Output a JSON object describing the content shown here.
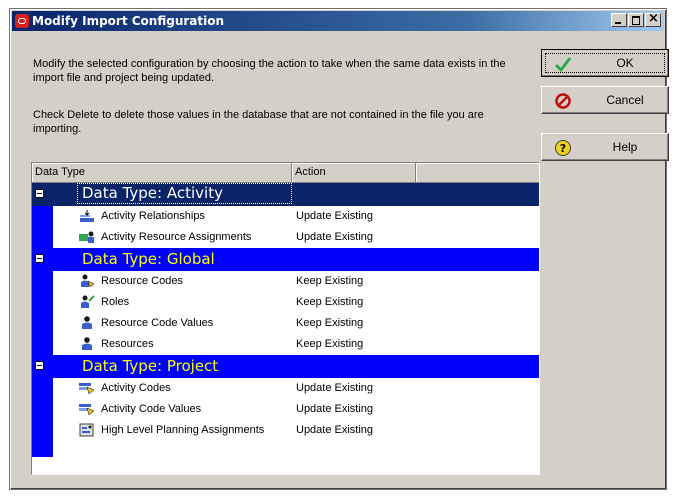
{
  "window": {
    "title": "Modify Import Configuration",
    "controls": {
      "minimize": "_",
      "maximize": "□",
      "close": "×"
    }
  },
  "instructions": {
    "line1": "Modify the selected configuration by choosing the action to take when the same data exists in the import file and project being updated.",
    "line2": "Check Delete to delete those values in the database that are not contained in the file you are importing."
  },
  "grid": {
    "columns": [
      "Data Type",
      "Action",
      ""
    ],
    "groups": [
      {
        "label": "Data Type: Activity",
        "selected": true,
        "items": [
          {
            "label": "Activity Relationships",
            "action": "Update Existing",
            "icon": "relationship-icon"
          },
          {
            "label": "Activity Resource Assignments",
            "action": "Update Existing",
            "icon": "resource-assignment-icon"
          }
        ]
      },
      {
        "label": "Data Type: Global",
        "selected": false,
        "items": [
          {
            "label": "Resource Codes",
            "action": "Keep Existing",
            "icon": "resource-codes-icon"
          },
          {
            "label": "Roles",
            "action": "Keep Existing",
            "icon": "roles-icon"
          },
          {
            "label": "Resource Code Values",
            "action": "Keep Existing",
            "icon": "resource-icon"
          },
          {
            "label": "Resources",
            "action": "Keep Existing",
            "icon": "resource-icon"
          }
        ]
      },
      {
        "label": "Data Type: Project",
        "selected": false,
        "items": [
          {
            "label": "Activity Codes",
            "action": "Update Existing",
            "icon": "activity-codes-icon"
          },
          {
            "label": "Activity Code Values",
            "action": "Update Existing",
            "icon": "activity-codes-icon"
          },
          {
            "label": "High Level Planning Assignments",
            "action": "Update Existing",
            "icon": "planning-assignment-icon"
          }
        ]
      }
    ]
  },
  "buttons": {
    "ok": "OK",
    "cancel": "Cancel",
    "help": "Help"
  },
  "colors": {
    "group_background": "#0000ff",
    "group_text": "#ffff00",
    "selected_background": "#0a246a",
    "dialog_face": "#d4d0c8"
  }
}
